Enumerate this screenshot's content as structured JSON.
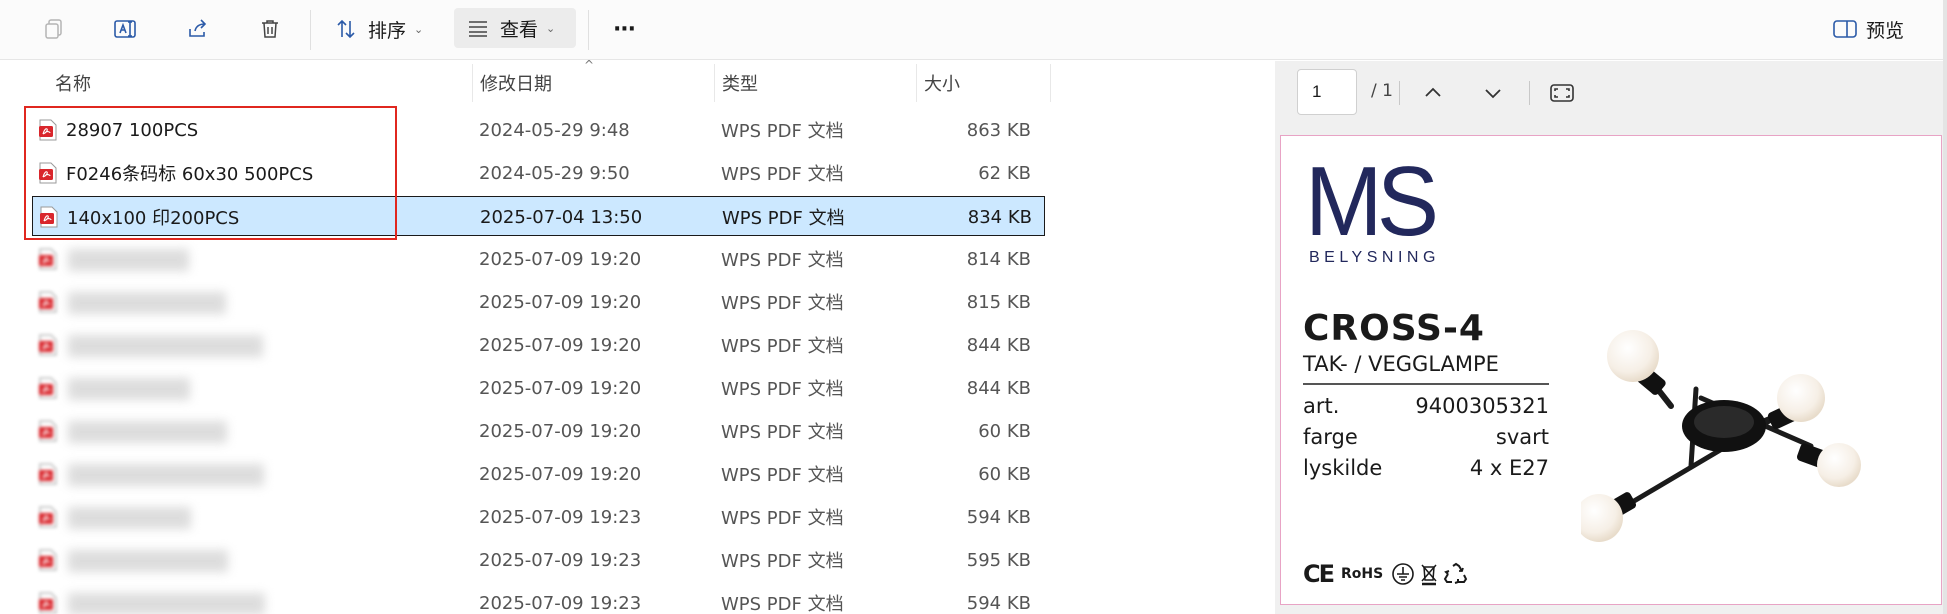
{
  "toolbar": {
    "sort_label": "排序",
    "view_label": "查看",
    "more_label": "···",
    "preview_label": "预览"
  },
  "columns": {
    "name": "名称",
    "date": "修改日期",
    "type": "类型",
    "size": "大小"
  },
  "files": [
    {
      "name": "28907 100PCS",
      "date": "2024-05-29 9:48",
      "type": "WPS PDF 文档",
      "size": "863 KB",
      "blurred": false
    },
    {
      "name": "F0246条码标 60x30 500PCS",
      "date": "2024-05-29 9:50",
      "type": "WPS PDF 文档",
      "size": "62 KB",
      "blurred": false
    },
    {
      "name": "140x100 印200PCS",
      "date": "2025-07-04 13:50",
      "type": "WPS PDF 文档",
      "size": "834 KB",
      "blurred": false,
      "selected": true
    },
    {
      "name": "",
      "date": "2025-07-09 19:20",
      "type": "WPS PDF 文档",
      "size": "814 KB",
      "blurred": true
    },
    {
      "name": "",
      "date": "2025-07-09 19:20",
      "type": "WPS PDF 文档",
      "size": "815 KB",
      "blurred": true
    },
    {
      "name": "",
      "date": "2025-07-09 19:20",
      "type": "WPS PDF 文档",
      "size": "844 KB",
      "blurred": true
    },
    {
      "name": "",
      "date": "2025-07-09 19:20",
      "type": "WPS PDF 文档",
      "size": "844 KB",
      "blurred": true
    },
    {
      "name": "",
      "date": "2025-07-09 19:20",
      "type": "WPS PDF 文档",
      "size": "60 KB",
      "blurred": true
    },
    {
      "name": "",
      "date": "2025-07-09 19:20",
      "type": "WPS PDF 文档",
      "size": "60 KB",
      "blurred": true
    },
    {
      "name": "",
      "date": "2025-07-09 19:23",
      "type": "WPS PDF 文档",
      "size": "594 KB",
      "blurred": true
    },
    {
      "name": "",
      "date": "2025-07-09 19:23",
      "type": "WPS PDF 文档",
      "size": "595 KB",
      "blurred": true
    },
    {
      "name": "",
      "date": "2025-07-09 19:23",
      "type": "WPS PDF 文档",
      "size": "594 KB",
      "blurred": true
    }
  ],
  "preview": {
    "page_current": "1",
    "page_total": "/ 1",
    "logo_main": "MS",
    "logo_sub": "BELYSNING",
    "product_name": "CROSS-4",
    "product_type": "TAK- / VEGGLAMPE",
    "specs": [
      {
        "key": "art.",
        "value": "9400305321"
      },
      {
        "key": "farge",
        "value": "svart"
      },
      {
        "key": "lyskilde",
        "value": "4 x E27"
      }
    ],
    "cert_ce": "CE",
    "cert_rohs": "RoHS"
  },
  "colors": {
    "selection": "#cce8ff",
    "highlight": "#e0271f",
    "pdf_red": "#d9262c",
    "brand_navy": "#22285c"
  },
  "icons": [
    "copy-icon",
    "rename-icon",
    "share-icon",
    "delete-icon",
    "sort-icon",
    "view-icon",
    "more-icon",
    "preview-pane-icon",
    "pdf-file-icon",
    "chevron-up-icon",
    "chevron-down-icon",
    "fit-page-icon"
  ]
}
